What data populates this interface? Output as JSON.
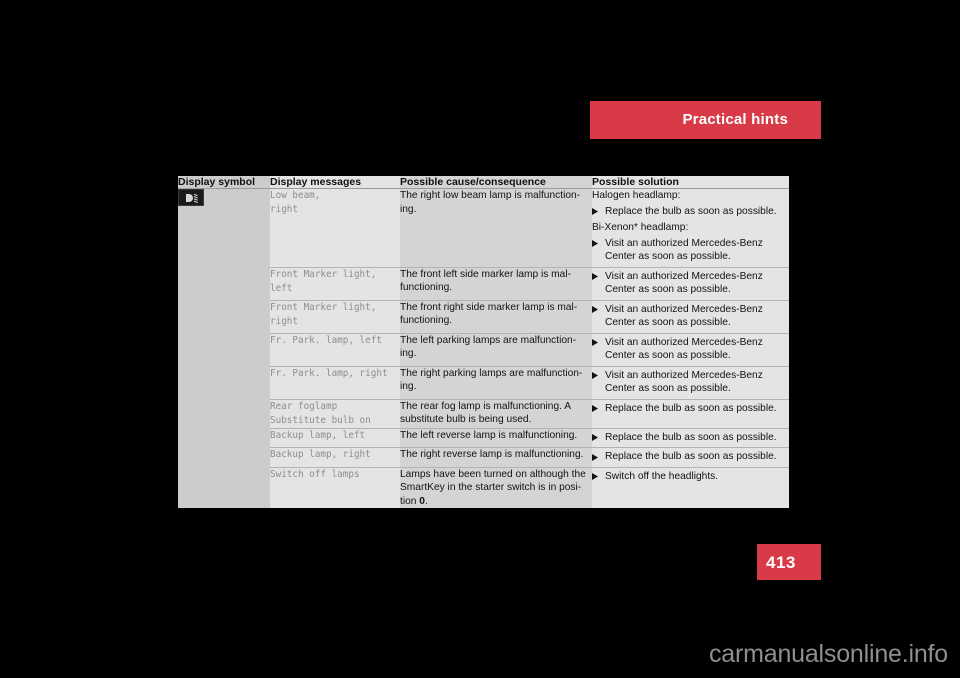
{
  "header": {
    "title": "Practical hints",
    "accent_color": "#d93a47"
  },
  "page_number": "413",
  "watermark": "carmanualsonline.info",
  "table": {
    "columns": [
      {
        "key": "symbol",
        "label": "Display symbol"
      },
      {
        "key": "message",
        "label": "Display messages"
      },
      {
        "key": "cause",
        "label": "Possible cause/consequence"
      },
      {
        "key": "solution",
        "label": "Possible solution"
      }
    ],
    "rows": [
      {
        "symbol_icon": "low-beam-headlamp-icon",
        "message": "Low beam,\nright",
        "cause": "The right low beam lamp is malfunction-\ning.",
        "solution_blocks": [
          {
            "type": "text",
            "text": "Halogen headlamp:"
          },
          {
            "type": "bullet",
            "text": "Replace the bulb as soon as possible."
          },
          {
            "type": "text",
            "text": "Bi-Xenon* headlamp:"
          },
          {
            "type": "bullet",
            "text": "Visit an authorized Mercedes-Benz Center as soon as possible."
          }
        ]
      },
      {
        "symbol_icon": "",
        "message": "Front Marker light,\nleft",
        "cause": "The front left side marker lamp is mal-\nfunctioning.",
        "solution_blocks": [
          {
            "type": "bullet",
            "text": "Visit an authorized Mercedes-Benz Center as soon as possible."
          }
        ]
      },
      {
        "symbol_icon": "",
        "message": "Front Marker light,\nright",
        "cause": "The front right side marker lamp is mal-\nfunctioning.",
        "solution_blocks": [
          {
            "type": "bullet",
            "text": "Visit an authorized Mercedes-Benz Center as soon as possible."
          }
        ]
      },
      {
        "symbol_icon": "",
        "message": "Fr. Park. lamp, left",
        "cause": "The left parking lamps are malfunction-\ning.",
        "solution_blocks": [
          {
            "type": "bullet",
            "text": "Visit an authorized Mercedes-Benz Center as soon as possible."
          }
        ]
      },
      {
        "symbol_icon": "",
        "message": "Fr. Park. lamp, right",
        "cause": "The right parking lamps are malfunction-\ning.",
        "solution_blocks": [
          {
            "type": "bullet",
            "text": "Visit an authorized Mercedes-Benz Center as soon as possible."
          }
        ]
      },
      {
        "symbol_icon": "",
        "message": "Rear foglamp\nSubstitute bulb on",
        "cause": "The rear fog lamp is malfunctioning. A\nsubstitute bulb is being used.",
        "solution_blocks": [
          {
            "type": "bullet",
            "text": "Replace the bulb as soon as possible."
          }
        ]
      },
      {
        "symbol_icon": "",
        "message": "Backup lamp, left",
        "cause": "The left reverse lamp is malfunctioning.",
        "solution_blocks": [
          {
            "type": "bullet",
            "text": "Replace the bulb as soon as possible."
          }
        ]
      },
      {
        "symbol_icon": "",
        "message": "Backup lamp, right",
        "cause": "The right reverse lamp is malfunctioning.",
        "solution_blocks": [
          {
            "type": "bullet",
            "text": "Replace the bulb as soon as possible."
          }
        ]
      },
      {
        "symbol_icon": "",
        "message": "Switch off lamps",
        "cause": "Lamps have been turned on although the\nSmartKey in the starter switch is in posi-\ntion 0.",
        "cause_bold_token": "0",
        "solution_blocks": [
          {
            "type": "bullet",
            "text": "Switch off the headlights."
          }
        ]
      }
    ]
  },
  "colors": {
    "page_background": "#000000",
    "table_symbol_col": "#cccccc",
    "table_message_col": "#e4e4e4",
    "table_cause_col": "#d4d4d4",
    "table_solution_col": "#e4e4e4",
    "table_header": "#d2d2d2"
  }
}
